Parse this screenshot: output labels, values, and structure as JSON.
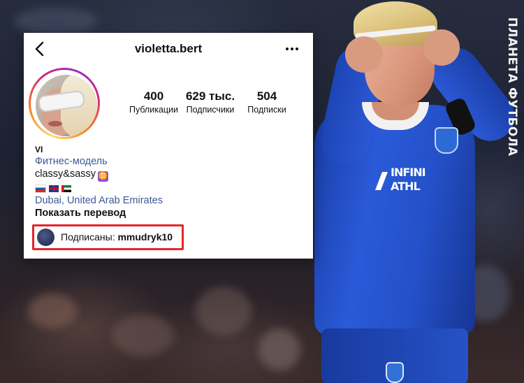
{
  "profile": {
    "username": "violetta.bert",
    "stats": [
      {
        "value": "400",
        "label": "Публикации"
      },
      {
        "value": "629 тыс.",
        "label": "Подписчики"
      },
      {
        "value": "504",
        "label": "Подписки"
      }
    ],
    "bio": {
      "name": "VI",
      "category": "Фитнес-модель",
      "tagline": "classy&sassy",
      "zodiac": "♊",
      "flags": [
        "russia-flag",
        "uk-flag",
        "uae-flag"
      ],
      "location": "Dubai, United Arab Emirates",
      "translate": "Показать перевод"
    },
    "followed_by": {
      "prefix": "Подписаны:",
      "account": "mmudryk10"
    }
  },
  "watermark": "ПЛАНЕТА ФУТБОЛА",
  "icons": {
    "back": "chevron-left-icon",
    "more": "more-horizontal-icon"
  },
  "colors": {
    "highlight_border": "#e3262b",
    "link": "#3b5a98",
    "jersey": "#2451c9",
    "story_ring": [
      "#feda75",
      "#fa7e1e",
      "#d62976",
      "#962fbf"
    ]
  }
}
